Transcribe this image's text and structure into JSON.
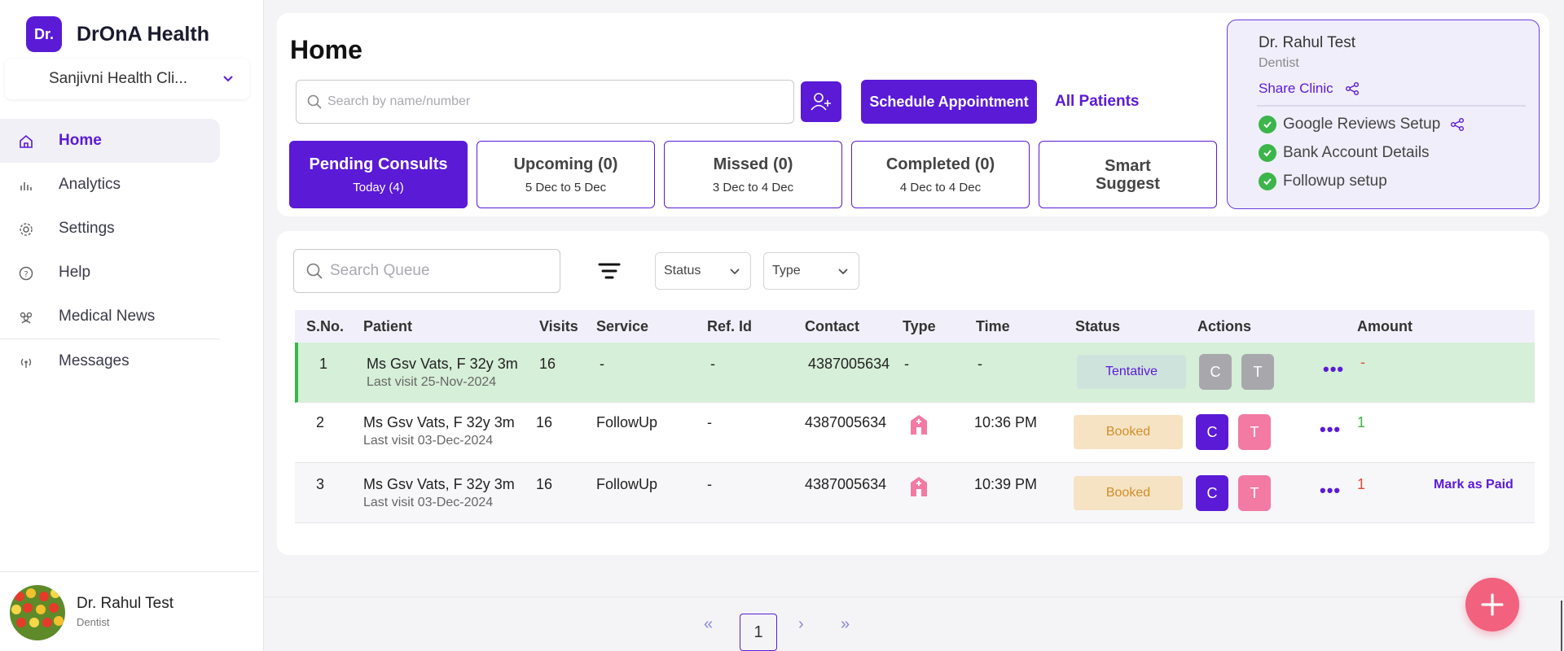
{
  "brand": {
    "logo_text": "Dr.",
    "name": "DrOnA Health",
    "accent": "#5a1ad6"
  },
  "clinic": {
    "selected": "Sanjivni Health Cli..."
  },
  "nav": [
    {
      "label": "Home",
      "icon": "home-icon",
      "active": true
    },
    {
      "label": "Analytics",
      "icon": "bar-chart-icon"
    },
    {
      "label": "Settings",
      "icon": "gear-icon"
    },
    {
      "label": "Help",
      "icon": "help-circle-icon"
    },
    {
      "label": "Medical News",
      "icon": "people-icon"
    },
    {
      "label": "Messages",
      "icon": "broadcast-icon"
    }
  ],
  "user": {
    "name": "Dr. Rahul Test",
    "role": "Dentist"
  },
  "header": {
    "title": "Home",
    "search_placeholder": "Search by name/number",
    "schedule_label": "Schedule Appointment",
    "all_patients_label": "All Patients"
  },
  "tabs": [
    {
      "title": "Pending Consults",
      "sub": "Today (4)",
      "active": true
    },
    {
      "title": "Upcoming (0)",
      "sub": "5 Dec to 5 Dec"
    },
    {
      "title": "Missed (0)",
      "sub": "3 Dec to 4 Dec"
    },
    {
      "title": "Completed (0)",
      "sub": "4 Dec to 4 Dec"
    },
    {
      "title": "Smart Suggest",
      "sub": ""
    }
  ],
  "profile_panel": {
    "name": "Dr. Rahul Test",
    "role": "Dentist",
    "share_label": "Share Clinic",
    "checklist": [
      "Google Reviews Setup",
      "Bank Account Details",
      "Followup setup"
    ]
  },
  "queue": {
    "search_placeholder": "Search Queue",
    "status_filter": "Status",
    "type_filter": "Type",
    "columns": [
      "S.No.",
      "Patient",
      "Visits",
      "Service",
      "Ref. Id",
      "Contact",
      "Type",
      "Time",
      "Status",
      "Actions",
      "Amount"
    ],
    "rows": [
      {
        "sno": "1",
        "patient": "Ms Gsv Vats, F 32y 3m",
        "last_visit": "Last visit 25-Nov-2024",
        "visits": "16",
        "service": "-",
        "ref": "-",
        "contact": "4387005634",
        "type": "-",
        "time": "-",
        "status": "Tentative",
        "c": "C",
        "t": "T",
        "amount": "-",
        "mark_paid": ""
      },
      {
        "sno": "2",
        "patient": "Ms Gsv Vats, F 32y 3m",
        "last_visit": "Last visit 03-Dec-2024",
        "visits": "16",
        "service": "FollowUp",
        "ref": "-",
        "contact": "4387005634",
        "type": "clinic-icon",
        "time": "10:36 PM",
        "status": "Booked",
        "c": "C",
        "t": "T",
        "amount": "1",
        "mark_paid": ""
      },
      {
        "sno": "3",
        "patient": "Ms Gsv Vats, F 32y 3m",
        "last_visit": "Last visit 03-Dec-2024",
        "visits": "16",
        "service": "FollowUp",
        "ref": "-",
        "contact": "4387005634",
        "type": "clinic-icon",
        "time": "10:39 PM",
        "status": "Booked",
        "c": "C",
        "t": "T",
        "amount": "1",
        "mark_paid": "Mark as Paid"
      }
    ]
  },
  "pagination": {
    "first": "«",
    "prev": "‹",
    "current": "1",
    "next": "›",
    "last": "»"
  },
  "more_label": "•••"
}
